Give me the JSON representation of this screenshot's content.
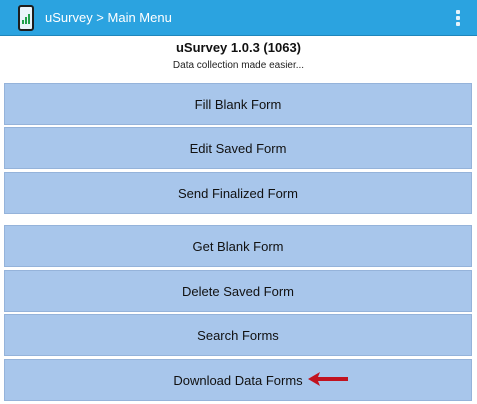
{
  "app_bar": {
    "title": "uSurvey > Main Menu",
    "icon": "app-phone-chart-icon",
    "overflow_icon": "vertical-dots-icon"
  },
  "header": {
    "title": "uSurvey 1.0.3 (1063)",
    "subtitle": "Data collection made easier..."
  },
  "menu": {
    "fill_blank_form": "Fill Blank Form",
    "edit_saved_form": "Edit Saved Form",
    "send_finalized_form": "Send Finalized Form",
    "get_blank_form": "Get Blank Form",
    "delete_saved_form": "Delete Saved Form",
    "search_forms": "Search Forms",
    "download_data_forms": "Download Data Forms"
  },
  "colors": {
    "app_bar": "#2ba3e0",
    "button": "#a8c6eb",
    "annotation_arrow": "#c1121f"
  }
}
